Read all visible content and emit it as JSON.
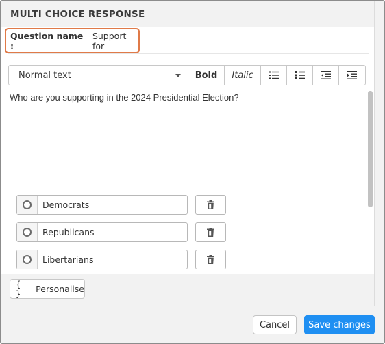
{
  "dialog": {
    "title": "MULTI CHOICE RESPONSE"
  },
  "question": {
    "label": "Question name :",
    "value": "Support for"
  },
  "toolbar": {
    "text_style": "Normal text",
    "bold_label": "Bold",
    "italic_label": "Italic",
    "icons": [
      "bullet-list-icon",
      "numbered-list-icon",
      "outdent-icon",
      "indent-icon"
    ]
  },
  "editor": {
    "text": "Who are you supporting in the 2024 Presidential Election?"
  },
  "options": [
    {
      "label": "Democrats"
    },
    {
      "label": "Republicans"
    },
    {
      "label": "Libertarians"
    }
  ],
  "personalise": {
    "icon_text": "{ }",
    "label": "Personalise"
  },
  "footer": {
    "cancel_label": "Cancel",
    "save_label": "Save changes"
  },
  "colors": {
    "accent": "#1f8ff2",
    "highlight_border": "#e07a48"
  }
}
